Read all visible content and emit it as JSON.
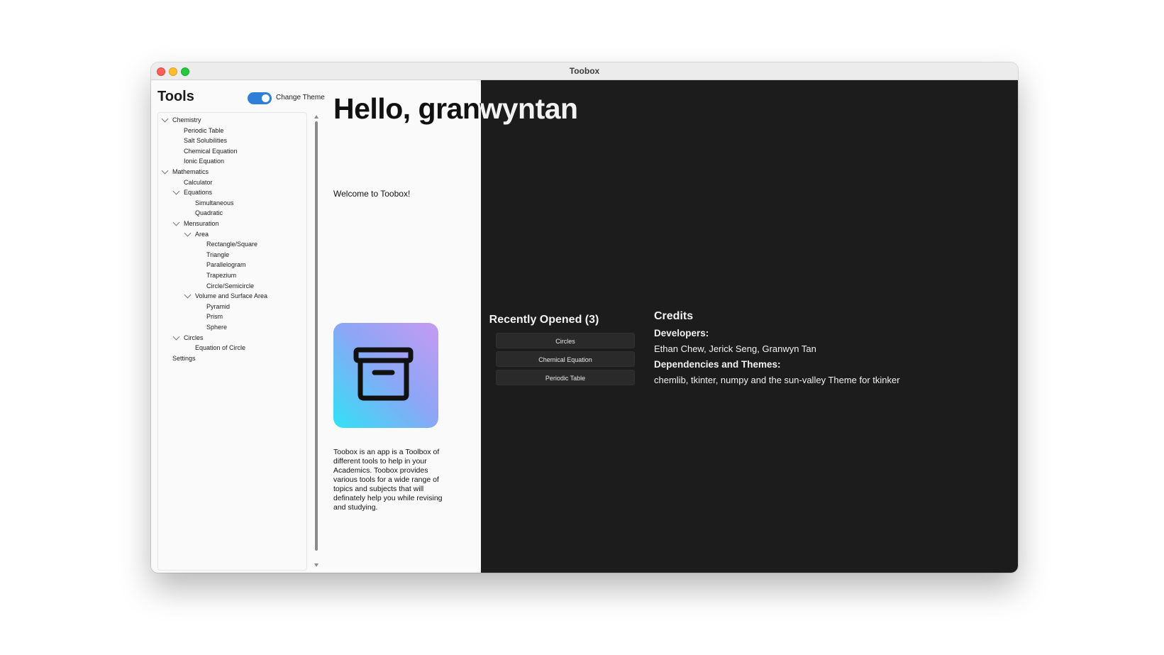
{
  "window": {
    "title": "Toobox"
  },
  "sidebar": {
    "title": "Tools",
    "toggle_label": "Change Theme",
    "toggle_on": true,
    "tree": [
      {
        "label": "Chemistry",
        "level": 0,
        "expanded": true
      },
      {
        "label": "Periodic Table",
        "level": 1
      },
      {
        "label": "Salt Solubilities",
        "level": 1
      },
      {
        "label": "Chemical Equation",
        "level": 1
      },
      {
        "label": "Ionic Equation",
        "level": 1
      },
      {
        "label": "Mathematics",
        "level": 0,
        "expanded": true
      },
      {
        "label": "Calculator",
        "level": 1
      },
      {
        "label": "Equations",
        "level": 1,
        "expanded": true
      },
      {
        "label": "Simultaneous",
        "level": 2
      },
      {
        "label": "Quadratic",
        "level": 2
      },
      {
        "label": "Mensuration",
        "level": 1,
        "expanded": true
      },
      {
        "label": "Area",
        "level": 2,
        "expanded": true
      },
      {
        "label": "Rectangle/Square",
        "level": 3
      },
      {
        "label": "Triangle",
        "level": 3
      },
      {
        "label": "Parallelogram",
        "level": 3
      },
      {
        "label": "Trapezium",
        "level": 3
      },
      {
        "label": "Circle/Semicircle",
        "level": 3
      },
      {
        "label": "Volume and Surface Area",
        "level": 2,
        "expanded": true
      },
      {
        "label": "Pyramid",
        "level": 3
      },
      {
        "label": "Prism",
        "level": 3
      },
      {
        "label": "Sphere",
        "level": 3
      },
      {
        "label": "Circles",
        "level": 1,
        "expanded": true
      },
      {
        "label": "Equation of Circle",
        "level": 2
      },
      {
        "label": "Settings",
        "level": 0
      }
    ]
  },
  "main": {
    "greeting": "Hello, granwyntan",
    "welcome": "Welcome to Toobox!",
    "description": "Toobox is an app is a Toolbox of different tools to help in your Academics. Toobox provides various tools for a wide range of topics and subjects that will definately help you while revising and studying.",
    "app_icon": "archive-box-icon"
  },
  "recent": {
    "title": "Recently Opened (3)",
    "items": [
      "Circles",
      "Chemical Equation",
      "Periodic Table"
    ]
  },
  "credits": {
    "title": "Credits",
    "developers_heading": "Developers:",
    "developers": "Ethan Chew, Jerick Seng, Granwyn Tan",
    "deps_heading": "Dependencies and Themes:",
    "deps": "chemlib, tkinter, numpy and the sun-valley Theme for tkinker"
  },
  "colors": {
    "accent": "#2f7fd8",
    "dark_bg": "#1c1c1c",
    "light_bg": "#fafafa"
  }
}
